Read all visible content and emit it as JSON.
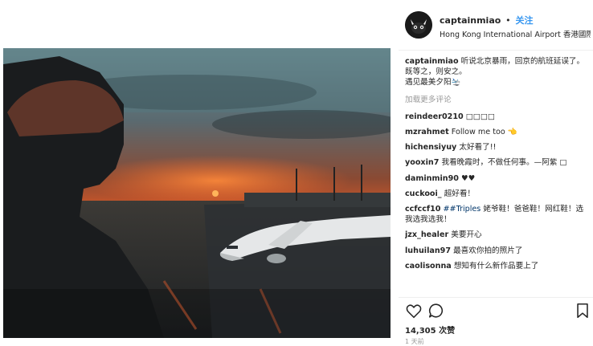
{
  "post": {
    "username": "captainmiao",
    "separator": "•",
    "follow_label": "关注",
    "location": "Hong Kong International Airport 香港國際...",
    "caption_user": "captainmiao",
    "caption_line1": "听说北京暴雨，回京的航班延误了。",
    "caption_line2": "既等之，则安之。",
    "caption_line3": "遇见最美夕阳🛬",
    "load_more": "加载更多评论",
    "likes": "14,305 次赞",
    "time_ago": "1 天前"
  },
  "comments": [
    {
      "user": "reindeer0210",
      "text": "□□□□"
    },
    {
      "user": "mzrahmet",
      "text": "Follow me too 👈"
    },
    {
      "user": "hichensiyuy",
      "text": "太好看了!!"
    },
    {
      "user": "yooxin7",
      "text": "我看晚霞时，不做任何事。—阿紫 □"
    },
    {
      "user": "daminmin90",
      "text": "♥♥"
    },
    {
      "user": "cuckooi_",
      "text": "超好看！"
    },
    {
      "user": "ccfccf10",
      "tag": "##Triples",
      "text": " 姥爷鞋！爸爸鞋！网红鞋！选我选我选我！"
    },
    {
      "user": "jzx_healer",
      "text": "美要开心"
    },
    {
      "user": "luhuilan97",
      "text": "最喜欢你拍的照片了"
    },
    {
      "user": "caolisonna",
      "text": "想知有什么新作品要上了"
    }
  ],
  "icons": {
    "avatar": "cat-avatar-icon",
    "like": "heart-icon",
    "comment": "comment-icon",
    "save": "bookmark-icon"
  },
  "colors": {
    "accent": "#3897f0",
    "sunset": "#e2582a",
    "secondary_text": "#999999"
  }
}
